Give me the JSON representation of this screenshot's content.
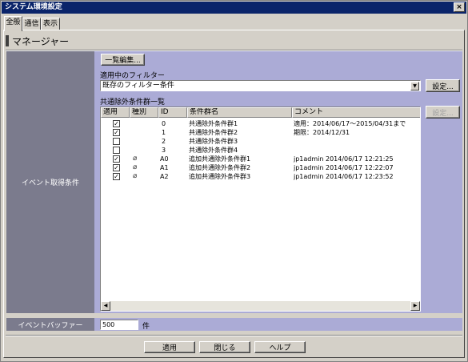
{
  "window": {
    "title": "システム環境設定",
    "close_glyph": "×"
  },
  "tabs": [
    {
      "label": "全般",
      "active": true
    },
    {
      "label": "通信",
      "active": false
    },
    {
      "label": "表示",
      "active": false
    }
  ],
  "section": {
    "title": "マネージャー"
  },
  "event_condition": {
    "label": "イベント取得条件",
    "list_edit_button": "一覧編集...",
    "filter_label": "適用中のフィルター",
    "filter_value": "既存のフィルター条件",
    "filter_settings_button": "設定...",
    "exclusion_label": "共通除外条件群一覧",
    "exclusion_settings_button": "設定...",
    "columns": [
      "適用",
      "種別",
      "ID",
      "条件群名",
      "コメント"
    ],
    "rows": [
      {
        "applied": true,
        "type": "",
        "id": "0",
        "name": "共通除外条件群1",
        "comment": "適用：2014/06/17〜2015/04/31まで"
      },
      {
        "applied": true,
        "type": "",
        "id": "1",
        "name": "共通除外条件群2",
        "comment": "期限：2014/12/31"
      },
      {
        "applied": false,
        "type": "",
        "id": "2",
        "name": "共通除外条件群3",
        "comment": ""
      },
      {
        "applied": false,
        "type": "",
        "id": "3",
        "name": "共通除外条件群4",
        "comment": ""
      },
      {
        "applied": true,
        "type": "clip",
        "id": "A0",
        "name": "追加共通除外条件群1",
        "comment": "jp1admin 2014/06/17 12:21:25"
      },
      {
        "applied": true,
        "type": "clip",
        "id": "A1",
        "name": "追加共通除外条件群2",
        "comment": "jp1admin 2014/06/17 12:22:07"
      },
      {
        "applied": true,
        "type": "clip",
        "id": "A2",
        "name": "追加共通除外条件群3",
        "comment": "jp1admin 2014/06/17 12:23:52"
      }
    ]
  },
  "event_buffer": {
    "label": "イベントバッファー",
    "value": "500",
    "unit": "件"
  },
  "footer": {
    "apply": "適用",
    "close": "閉じる",
    "help": "ヘルプ"
  },
  "glyphs": {
    "check": "✓",
    "clip": "⌀",
    "arrow_down": "▼",
    "arrow_left": "◀",
    "arrow_right": "▶"
  },
  "colors": {
    "titlebar": "#0a246a",
    "label_column": "#7b7b8d",
    "content_area": "#ababd6",
    "face": "#d4d0c8"
  }
}
